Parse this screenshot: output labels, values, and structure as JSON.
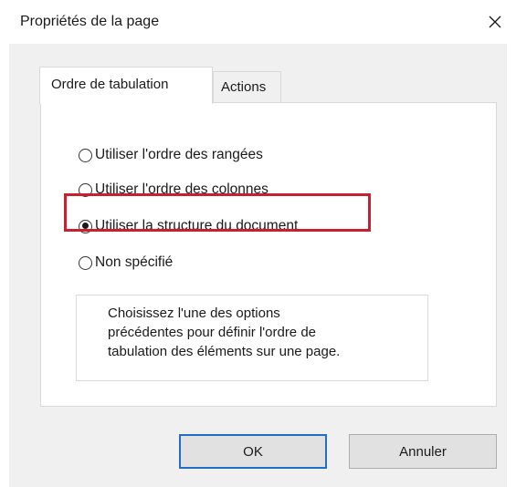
{
  "dialog": {
    "title": "Propriétés de la page"
  },
  "tabs": [
    {
      "label": "Ordre de tabulation",
      "active": true
    },
    {
      "label": "Actions",
      "active": false
    }
  ],
  "tab_order": {
    "options": [
      {
        "label": "Utiliser l'ordre des rangées",
        "checked": false
      },
      {
        "label": "Utiliser l'ordre des colonnes",
        "checked": false
      },
      {
        "label": "Utiliser la structure du document",
        "checked": true
      },
      {
        "label": "Non spécifié",
        "checked": false
      }
    ],
    "description_lines": [
      "Choisissez l'une des options",
      "précédentes pour définir l'ordre de",
      "tabulation des éléments sur une page."
    ]
  },
  "buttons": {
    "ok_label": "OK",
    "cancel_label": "Annuler"
  },
  "colors": {
    "highlight": "#c8202e",
    "focus_border": "#1f6fc9"
  }
}
